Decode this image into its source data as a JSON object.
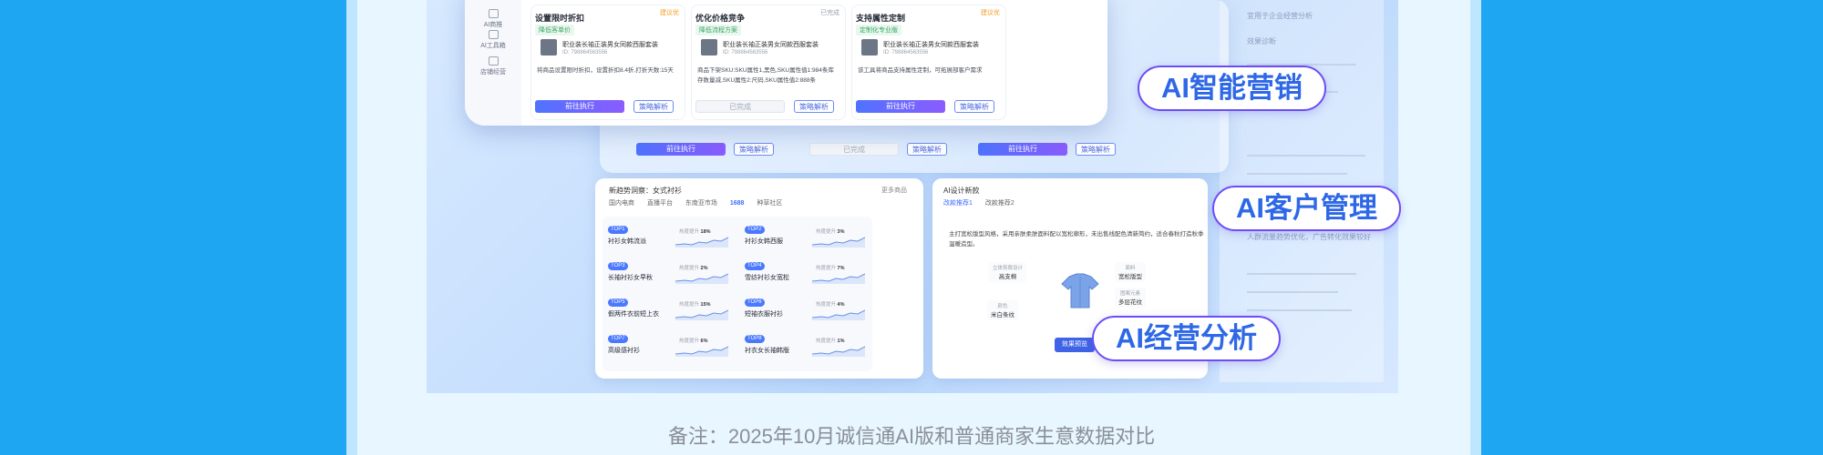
{
  "sidebar": {
    "items": [
      {
        "label": "AI商推",
        "icon": "ai-marketing-icon"
      },
      {
        "label": "AI工具箱",
        "icon": "toolbox-icon"
      },
      {
        "label": "店铺经营",
        "icon": "store-icon"
      }
    ]
  },
  "cards": [
    {
      "title": "设置限时折扣",
      "tag": "降低客单价",
      "badge": "建议优",
      "product": "职业装长袖正装男女同款西服套装",
      "pid": "ID: 798864563556",
      "desc": "将商品设置限时折扣，设置折扣8.4折,打折天数:15天",
      "primary_btn": "前往执行",
      "secondary_btn": "策略解析"
    },
    {
      "title": "优化价格竞争",
      "tag": "降低流程方案",
      "badge": "已完成",
      "product": "职业装长袖正装男女同款西服套装",
      "pid": "ID: 798864563556",
      "desc": "商品下架SKU:SKU属性1,黑色,SKU属性值1:984条库存数量减,SKU属性2:尺码,SKU属性值2:888条",
      "primary_btn": "已完成",
      "secondary_btn": "策略解析"
    },
    {
      "title": "支持属性定制",
      "tag": "定制化专业版",
      "badge": "建议优",
      "product": "职业装长袖正装男女同款西服套装",
      "pid": "ID: 798864563556",
      "desc": "该工具将商品支持属性定制，可拓展部客户需求",
      "primary_btn": "前往执行",
      "secondary_btn": "策略解析"
    }
  ],
  "strip": {
    "primary": "前往执行",
    "secondary": "策略解析",
    "done": "已完成"
  },
  "trend": {
    "title": "新趋势洞察：女式衬衫",
    "more": "更多商品",
    "tabs": [
      "国内电商",
      "直播平台",
      "东南亚市场",
      "1688",
      "种草社区"
    ],
    "items": [
      {
        "badge": "TOP1",
        "name": "衬衫女韩流派",
        "metric_label": "热度提升",
        "metric": "18%"
      },
      {
        "badge": "TOP2",
        "name": "衬衫女韩西服",
        "metric_label": "热度提升",
        "metric": "3%"
      },
      {
        "badge": "TOP3",
        "name": "长袖衬衫女早秋",
        "metric_label": "热度提升",
        "metric": "2%"
      },
      {
        "badge": "TOP4",
        "name": "雪纺衬衫女宽松",
        "metric_label": "热度提升",
        "metric": "7%"
      },
      {
        "badge": "TOP5",
        "name": "假两件衣前短上衣",
        "metric_label": "热度提升",
        "metric": "15%"
      },
      {
        "badge": "TOP6",
        "name": "短袖衣服衬衫",
        "metric_label": "热度提升",
        "metric": "4%"
      },
      {
        "badge": "TOP7",
        "name": "高级感衬衫",
        "metric_label": "热度提升",
        "metric": "6%"
      },
      {
        "badge": "TOP8",
        "name": "衬衣女长袖韩版",
        "metric_label": "热度提升",
        "metric": "1%"
      }
    ]
  },
  "design": {
    "title": "AI设计新款",
    "tabs": [
      "改款推荐1",
      "改款推荐2"
    ],
    "desc": "主打宽松版型风格，采用亲肤柔肤面料配以宽松廓形，未出售线配色清新简约，适合春秋打造秋季温暖造型。",
    "points": [
      {
        "sub": "立体剪裁设计",
        "text": "高支棉"
      },
      {
        "sub": "面料",
        "text": "宽松版型"
      },
      {
        "sub": "图案元素",
        "text": "多层花纹"
      },
      {
        "sub": "颜色",
        "text": "米白条纹"
      }
    ],
    "button": "效果预览"
  },
  "right_panel": {
    "title": "宜用于企业经营分析",
    "section": "效果诊断",
    "note": "人群流量趋势优化，广告转化效果较好"
  },
  "badges": {
    "marketing": "AI智能营销",
    "customer": "AI客户管理",
    "analysis": "AI经营分析"
  },
  "footnote": "备注：2025年10月诚信通AI版和普通商家生意数据对比",
  "colors": {
    "page_bg": "#1fa6f3",
    "brand_blue": "#2e68e6",
    "accent_purple": "#6b4df6"
  }
}
